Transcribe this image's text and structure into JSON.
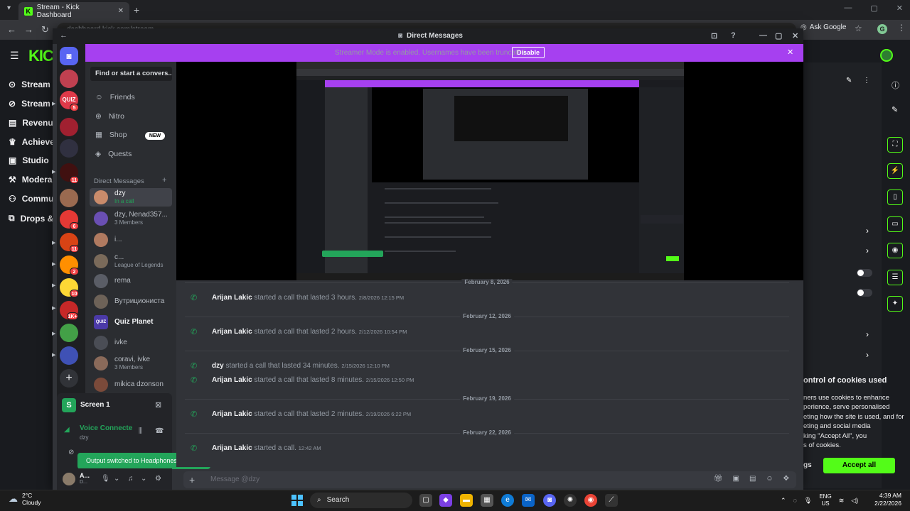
{
  "browser": {
    "tab_title": "Stream - Kick Dashboard",
    "tab_close": "✕",
    "new_tab": "+",
    "url": "dashboard.kick.com/stream",
    "ask_google": "Ask Google",
    "profile_initial": "G"
  },
  "kick": {
    "logo": "KICK",
    "nav": [
      "Stream",
      "Stream",
      "Revenu",
      "Achieve",
      "Studio",
      "Modera",
      "Commu",
      "Drops &"
    ],
    "cookie_title": "ontrol of cookies used",
    "cookie_body": "ners use cookies to enhance\nperience, serve personalised\neting how the site is used, and for\neting and social media\nking \"Accept All\", you\ns of cookies.",
    "settings_label": "gs",
    "accept_all": "Accept all",
    "accent_color": "#53fc18"
  },
  "discord": {
    "window_title": "Direct Messages",
    "streamer_banner": "Streamer Mode is enabled. Usernames have been truncated.",
    "disable_button": "Disable",
    "find_placeholder": "Find or start a convers...",
    "menu": [
      {
        "label": "Friends",
        "icon": "friends-icon"
      },
      {
        "label": "Nitro",
        "icon": "nitro-icon"
      },
      {
        "label": "Shop",
        "icon": "shop-icon"
      },
      {
        "label": "Quests",
        "icon": "quests-icon"
      }
    ],
    "new_badge": "NEW",
    "dm_header": "Direct Messages",
    "dms": [
      {
        "name": "dzy",
        "sub": "In a call"
      },
      {
        "name": "dzy, Nenad357...",
        "sub": "3 Members"
      },
      {
        "name": "i...",
        "sub": ""
      },
      {
        "name": "c...",
        "sub": "League of Legends"
      },
      {
        "name": "rema",
        "sub": ""
      },
      {
        "name": "Вутрициониста",
        "sub": ""
      },
      {
        "name": "Quiz Planet",
        "sub": ""
      },
      {
        "name": "ivke",
        "sub": ""
      },
      {
        "name": "coravi, ivke",
        "sub": "3 Members"
      },
      {
        "name": "mikica dzonson",
        "sub": ""
      }
    ],
    "server_badges": [
      "5",
      "6",
      "11",
      "6",
      "11",
      "2",
      "10",
      "1K+"
    ],
    "screen_panel": {
      "label": "Screen 1",
      "icon_letter": "S"
    },
    "voice": {
      "status": "Voice Connecte",
      "channel": "dzy"
    },
    "toast": "Output switched to Headphones (AirPo...",
    "user": {
      "name": "A...",
      "status": "D..."
    },
    "messages": [
      {
        "date": "February 8, 2026",
        "author": "Arijan Lakic",
        "text": "started a call that lasted 3 hours.",
        "time": "2/8/2026 12:15 PM"
      },
      {
        "date": "February 12, 2026",
        "author": "Arijan Lakic",
        "text": "started a call that lasted 2 hours.",
        "time": "2/12/2026 10:54 PM"
      },
      {
        "date": "February 15, 2026",
        "author": "dzy",
        "text": "started a call that lasted 34 minutes.",
        "time": "2/15/2026 12:10 PM"
      },
      {
        "date": "",
        "author": "Arijan Lakic",
        "text": "started a call that lasted 8 minutes.",
        "time": "2/15/2026 12:50 PM"
      },
      {
        "date": "February 19, 2026",
        "author": "Arijan Lakic",
        "text": "started a call that lasted 2 minutes.",
        "time": "2/19/2026 6:22 PM"
      },
      {
        "date": "February 22, 2026",
        "author": "Arijan Lakic",
        "text": "started a call.",
        "time": "12:42 AM"
      }
    ],
    "composer_placeholder": "Message @dzy",
    "banner_color": "#a640f0",
    "call_green": "#23a55a"
  },
  "taskbar": {
    "temperature": "2°C",
    "weather": "Cloudy",
    "search": "Search",
    "language": "ENG",
    "region": "US",
    "time": "4:39 AM",
    "date": "2/22/2026"
  }
}
